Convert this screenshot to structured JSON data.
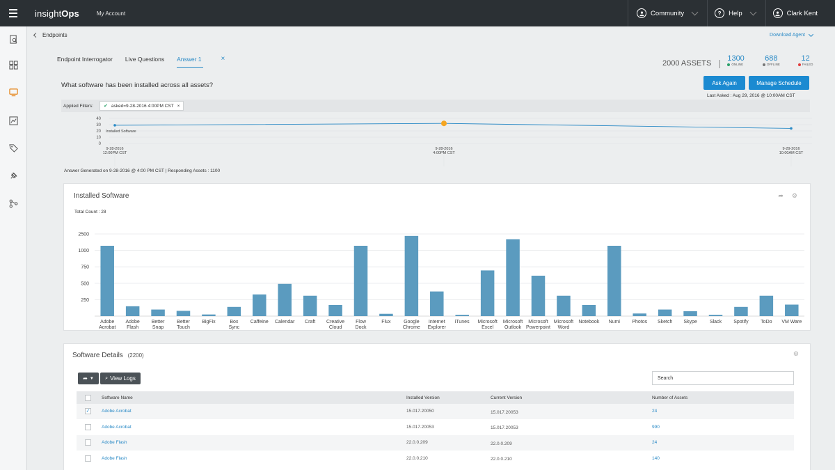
{
  "topbar": {
    "logo_prefix": "insight",
    "logo_suffix": "Ops",
    "my_account": "My Account",
    "community": "Community",
    "help": "Help",
    "user": "Clark Kent"
  },
  "breadcrumb": {
    "label": "Endpoints"
  },
  "download_agent": "Download Agent",
  "tabs": [
    {
      "label": "Endpoint Interrogator"
    },
    {
      "label": "Live Questions"
    },
    {
      "label": "Answer 1"
    }
  ],
  "assets": {
    "total": "2000 ASSETS",
    "online_num": "1300",
    "online_lbl": "ONLINE",
    "offline_num": "688",
    "offline_lbl": "OFFLINE",
    "failed_num": "12",
    "failed_lbl": "FAILED",
    "colors": {
      "online": "#2aa06a",
      "offline": "#777777",
      "failed": "#e03c3c"
    }
  },
  "question": "What software has been installed across all assets?",
  "buttons": {
    "ask_again": "Ask Again",
    "manage_schedule": "Manage Schedule"
  },
  "last_asked": "Last Asked : Aug 29, 2016 @ 10:00AM CST",
  "filters": {
    "label": "Applied Filters:",
    "chip": "asked=9-28-2016 4:00PM CST",
    "chip_close": "×"
  },
  "timeline": {
    "yticks": [
      "40",
      "30",
      "20",
      "10",
      "0"
    ],
    "series_label": "Installed Software",
    "points": [
      {
        "date": "9-28-2016",
        "time": "12:00PM CST",
        "value": 29
      },
      {
        "date": "9-28-2016",
        "time": "4:00PM CST",
        "value": 32
      },
      {
        "date": "9-29-2016",
        "time": "10:00AM CST",
        "value": 24
      }
    ],
    "highlight_color": "#f5a623",
    "line_color": "#2a8ac6"
  },
  "generated": "Answer Generated on 9-28-2016 @ 4:00 PM CST | Responding Assets : 1100",
  "installed_panel": {
    "title": "Installed Software",
    "total_count": "Total Count : 28"
  },
  "chart_data": {
    "type": "bar",
    "title": "Installed Software",
    "color": "#5b9bbf",
    "yticks": [
      "2500",
      "1000",
      "750",
      "500",
      "250"
    ],
    "ytick_positions": [
      2500,
      2000,
      1500,
      1000,
      500
    ],
    "ylim": [
      0,
      2500
    ],
    "categories": [
      "Adobe Acrobat",
      "Adobe Flash",
      "Better Snap",
      "Better Touch",
      "BigFix",
      "Box Sync",
      "Caffeine",
      "Calendar",
      "Craft",
      "Creative Cloud",
      "Flow Dock",
      "Flux",
      "Google Chrome",
      "Internet Explorer",
      "iTunes",
      "Microsoft Excel",
      "Microsoft Outlook",
      "Microsoft Powerpoint",
      "Microsoft Word",
      "Notebook",
      "Numi",
      "Photos",
      "Sketch",
      "Skype",
      "Slack",
      "Spotify",
      "ToDo",
      "VM Ware"
    ],
    "labels": [
      [
        "Adobe",
        "Acrobat"
      ],
      [
        "Adobe",
        "Flash"
      ],
      [
        "Better",
        "Snap"
      ],
      [
        "Better",
        "Touch"
      ],
      [
        "BigFix"
      ],
      [
        "Box",
        "Sync"
      ],
      [
        "Caffeine"
      ],
      [
        "Calendar"
      ],
      [
        "Craft"
      ],
      [
        "Creative",
        "Cloud"
      ],
      [
        "Flow",
        "Dock"
      ],
      [
        "Flux"
      ],
      [
        "Google",
        "Chrome"
      ],
      [
        "Internet",
        "Explorer"
      ],
      [
        "iTunes"
      ],
      [
        "Microsoft",
        "Excel"
      ],
      [
        "Microsoft",
        "Outlook"
      ],
      [
        "Microsoft",
        "Powerpoint"
      ],
      [
        "Microsoft",
        "Word"
      ],
      [
        "Notebook"
      ],
      [
        "Numi"
      ],
      [
        "Photos"
      ],
      [
        "Sketch"
      ],
      [
        "Skype"
      ],
      [
        "Slack"
      ],
      [
        "Spotify"
      ],
      [
        "ToDo"
      ],
      [
        "VM Ware"
      ]
    ],
    "values": [
      2140,
      300,
      200,
      160,
      50,
      280,
      660,
      980,
      620,
      340,
      2140,
      70,
      2440,
      750,
      40,
      1390,
      2340,
      1230,
      620,
      340,
      2140,
      80,
      200,
      150,
      40,
      280,
      620,
      350
    ]
  },
  "details_panel": {
    "title": "Software Details",
    "count": "(2200)",
    "view_logs": "View Logs",
    "search_placeholder": "Search",
    "columns": [
      "Software Name",
      "Installed Version",
      "Current Version",
      "Number of Assets"
    ],
    "rows": [
      {
        "checked": true,
        "name": "Adobe Acrobat",
        "installed": "15.017.20050",
        "current": "15.017.20053",
        "assets": "24"
      },
      {
        "checked": false,
        "name": "Adobe Acrobat",
        "installed": "15.017.20053",
        "current": "15.017.20053",
        "assets": "990"
      },
      {
        "checked": false,
        "name": "Adobe Flash",
        "installed": "22.0.0.209",
        "current": "22.0.0.209",
        "assets": "24"
      },
      {
        "checked": false,
        "name": "Adobe Flash",
        "installed": "22.0.0.210",
        "current": "22.0.0.210",
        "assets": "140"
      }
    ]
  }
}
